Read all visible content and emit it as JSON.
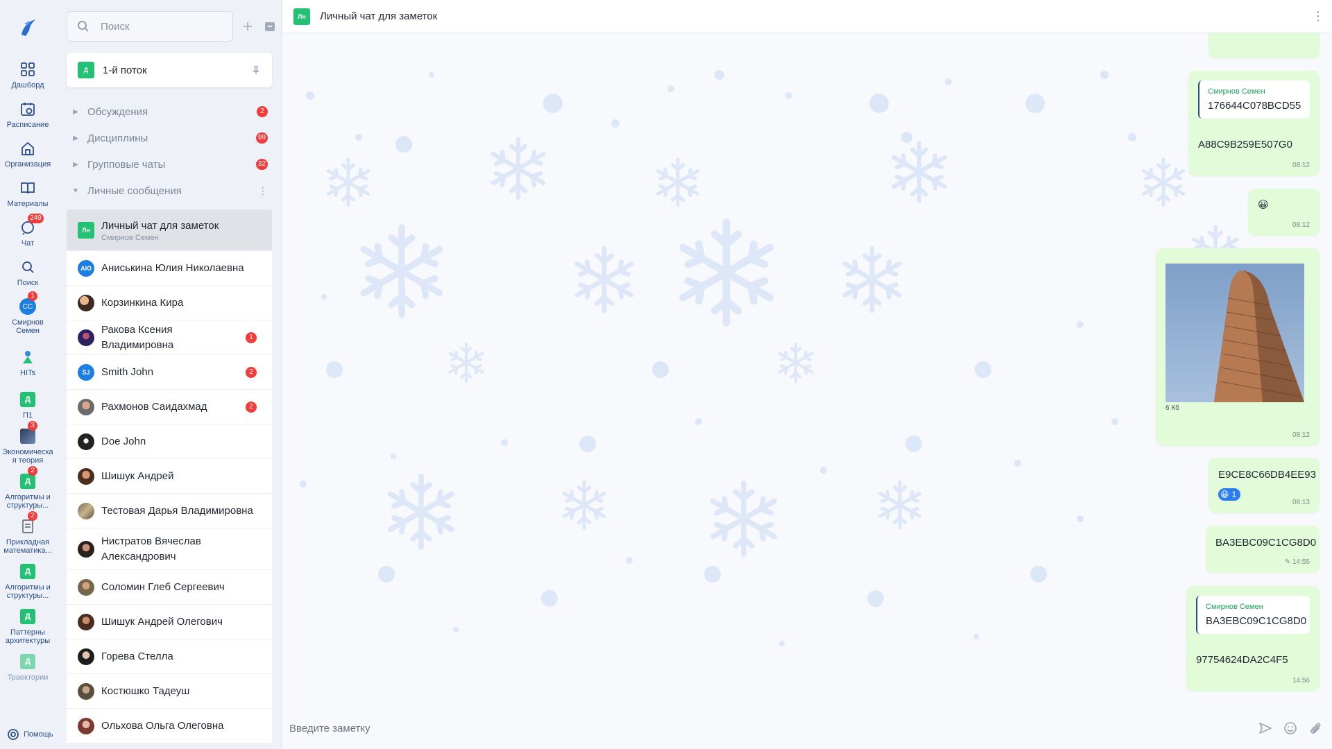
{
  "rail": {
    "items": [
      {
        "label": "Дашборд",
        "icon": "grid-icon"
      },
      {
        "label": "Расписание",
        "icon": "calendar-icon"
      },
      {
        "label": "Организация",
        "icon": "building-icon"
      },
      {
        "label": "Материалы",
        "icon": "book-icon"
      },
      {
        "label": "Чат",
        "icon": "chat-icon",
        "badge": "249"
      },
      {
        "label": "Поиск",
        "icon": "search-icon"
      },
      {
        "label": "Смирнов Семен",
        "avatar": "СС",
        "badge": "1"
      },
      {
        "label": "HITs",
        "icon": "hits-logo"
      },
      {
        "label": "П1",
        "square": "Д"
      },
      {
        "label": "Экономическая теория",
        "badge": "3"
      },
      {
        "label": "Алгоритмы и структуры...",
        "square": "Д",
        "badge": "2"
      },
      {
        "label": "Прикладная математика...",
        "badge": "2"
      },
      {
        "label": "Алгоритмы и структуры...",
        "square": "Д"
      },
      {
        "label": "Паттерны архитектуры",
        "square": "Д"
      },
      {
        "label": "Траектории",
        "square": "Д"
      }
    ],
    "help_label": "Помощь"
  },
  "sidebar": {
    "search_placeholder": "Поиск",
    "stream": {
      "badge": "Д",
      "title": "1-й поток"
    },
    "sections": [
      {
        "name": "Обсуждения",
        "count": "2"
      },
      {
        "name": "Дисциплины",
        "count": "99"
      },
      {
        "name": "Групповые чаты",
        "count": "32"
      },
      {
        "name": "Личные сообщения",
        "count": ""
      }
    ],
    "dms": [
      {
        "name": "Личный чат для заметок",
        "sub": "Смирнов Семен",
        "avatar": "Лн",
        "count": ""
      },
      {
        "name": "Аниськина Юлия Николаевна",
        "avatar": "АЮ",
        "count": ""
      },
      {
        "name": "Корзинкина Кира",
        "count": ""
      },
      {
        "name": "Ракова Ксения Владимировна",
        "count": "1"
      },
      {
        "name": "Smith John",
        "avatar": "SJ",
        "count": "2"
      },
      {
        "name": "Рахмонов Саидахмад",
        "count": "2"
      },
      {
        "name": "Doe John",
        "count": ""
      },
      {
        "name": "Шишук Андрей",
        "count": ""
      },
      {
        "name": "Тестовая Дарья Владимировна",
        "count": ""
      },
      {
        "name": "Нистратов Вячеслав Александрович",
        "count": ""
      },
      {
        "name": "Соломин Глеб Сергеевич",
        "count": ""
      },
      {
        "name": "Шишук Андрей Олегович",
        "count": ""
      },
      {
        "name": "Горева Стелла",
        "count": ""
      },
      {
        "name": "Костюшко Тадеуш",
        "count": ""
      },
      {
        "name": "Ольхова Ольга Олеговна",
        "count": ""
      }
    ]
  },
  "chat": {
    "header_avatar": "Лн",
    "title": "Личный чат для заметок",
    "messages": [
      {
        "quote_author": "Смирнов Семен",
        "quote_text": "176644C078BCD55",
        "text": "A88C9B259E507G0",
        "time": "08:12"
      },
      {
        "text": "😀",
        "time": "08:12"
      },
      {
        "file_size": "6 Кб",
        "time": "08:12"
      },
      {
        "text": "E9CE8C66DB4EE93",
        "reaction_emoji": "😀",
        "reaction_count": "1",
        "time": "08:13"
      },
      {
        "text": "BA3EBC09C1CG8D0",
        "time": "14:55"
      },
      {
        "quote_author": "Смирнов Семен",
        "quote_text": "BA3EBC09C1CG8D0",
        "text": "97754624DA2C4F5",
        "time": "14:56"
      }
    ],
    "composer_placeholder": "Введите заметку"
  },
  "colors": {
    "accent": "#22c173",
    "badge": "#f23b3b",
    "bubble": "#e2fbd9",
    "nav": "#2a4b8d"
  }
}
